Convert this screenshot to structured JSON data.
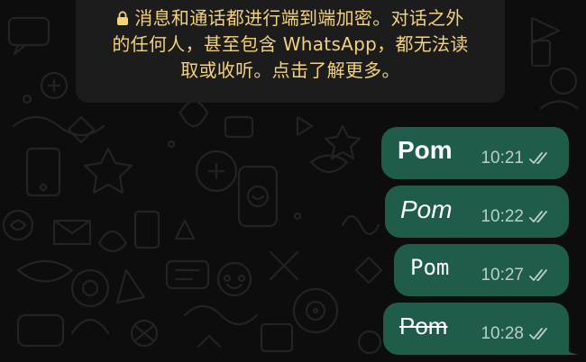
{
  "notice": {
    "icon": "lock-icon",
    "lines": [
      "消息和通话都进行端到端加密。对话之外",
      "的任何人，甚至包含 WhatsApp，都无法读",
      "取或收听。点击了解更多。"
    ],
    "color": "#f4d27a"
  },
  "messages": [
    {
      "text": "Pom",
      "style": "bold",
      "time": "10:21",
      "status_icon": "double-check-icon"
    },
    {
      "text": "Pom",
      "style": "italic",
      "time": "10:22",
      "status_icon": "double-check-icon"
    },
    {
      "text": "Pom",
      "style": "monospace",
      "time": "10:27",
      "status_icon": "double-check-icon"
    },
    {
      "text": "Pom",
      "style": "strikethrough",
      "time": "10:28",
      "status_icon": "double-check-icon"
    }
  ],
  "colors": {
    "bubble": "#1f5c4a",
    "background": "#0d0d0d"
  }
}
